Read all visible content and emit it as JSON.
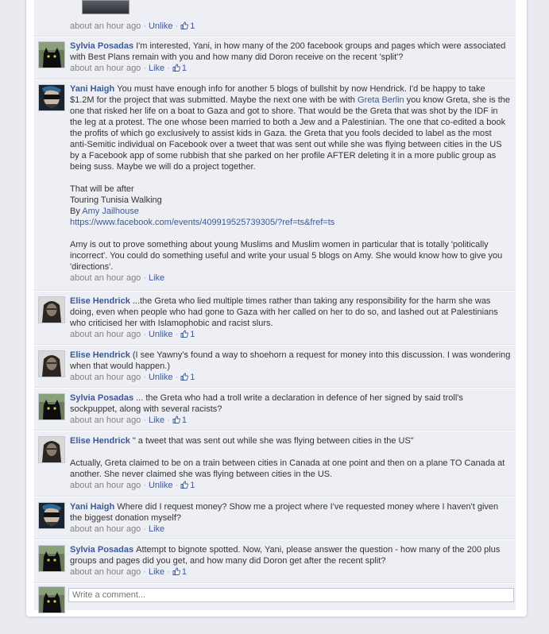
{
  "colors": {
    "link": "#3b5998",
    "meta": "#808080",
    "panel_bg": "#edeff4"
  },
  "first_meta": {
    "time": "about an hour ago",
    "action": "Unlike",
    "likes": "1"
  },
  "comments": [
    {
      "author": "Sylvia Posadas",
      "avatar_icon": "black-cat-avatar",
      "text": "I'm interested, Yani, in how many of the 200 facebook groups and pages which were associated with Best Plans remain with you and how many did Doron receive on the recent 'split'?",
      "time": "about an hour ago",
      "action": "Like",
      "likes": "1"
    },
    {
      "author": "Yani Haigh",
      "avatar_icon": "masked-face-avatar",
      "text_a": "You must have enough info for another 5 blogs of bullshit by now Hendrick. I'd be happy to take $1.2M for the project that was submitted. Maybe the next one with be with",
      "link_a": "Greta Berlin",
      "text_b": "you know Greta, she is the one that risked her life on a boat to Gaza and got to shore. That would be the Greta that was shot by the IDF in the leg at a protest. The one whose been married to both a Jew and a Palestinian. The one that co-edited a book the profits of which go exclusively to assist kids in Gaza. the Greta that you fools decided to label as the most anti-Semitic individual on Facebook over a tweet that was sent out while she was flying between cities in the US by a Facebook app of some rubbish that she parked on her profile AFTER deleting it in a more public group as being suss. Maybe we will do a project together.",
      "line1": "That will be after",
      "line2": "Touring Tunisia Walking",
      "by_label": "By",
      "by_link": "Amy Jailhouse",
      "url": "https://www.facebook.com/events/409919525739305/?ref=ts&fref=ts",
      "text_c": "Amy is out to prove something about young Muslims and Muslim women in particular that is totally 'politically incorrect'. You could do something useful and write your usual 5 blogs on Amy. She would know how to give you 'directions'.",
      "time": "about an hour ago",
      "action": "Like"
    },
    {
      "author": "Elise Hendrick",
      "avatar_icon": "woman-face-avatar",
      "text": "...the Greta who lied multiple times rather than taking any responsibility for the harm she was doing, even when people who had gone to Gaza with her called on her to do so, and lashed out at Palestinians who criticised her with Islamophobic and racist slurs.",
      "time": "about an hour ago",
      "action": "Unlike",
      "likes": "1"
    },
    {
      "author": "Elise Hendrick",
      "avatar_icon": "woman-face-avatar",
      "text": "(I see Yawny's found a way to shoehorn a request for money into this discussion. I was wondering when that would happen.)",
      "time": "about an hour ago",
      "action": "Unlike",
      "likes": "1"
    },
    {
      "author": "Sylvia Posadas",
      "avatar_icon": "black-cat-avatar",
      "text": "... the Greta who had a troll write a declaration in defence of her signed by said troll's sockpuppet, along with several racists?",
      "time": "about an hour ago",
      "action": "Like",
      "likes": "1"
    },
    {
      "author": "Elise Hendrick",
      "avatar_icon": "woman-face-avatar",
      "text": "\" a tweet that was sent out while she was flying between cities in the US\"",
      "text2": "Actually, Greta claimed to be on a train between cities in Canada at one point and then on a plane TO Canada at another. She never claimed she was flying between cities in the US.",
      "time": "about an hour ago",
      "action": "Unlike",
      "likes": "1"
    },
    {
      "author": "Yani Haigh",
      "avatar_icon": "masked-face-avatar",
      "text": "Where did I request money? Show me a project where I've requested money where I haven't given the biggest donation myself?",
      "time": "about an hour ago",
      "action": "Like"
    },
    {
      "author": "Sylvia Posadas",
      "avatar_icon": "black-cat-avatar",
      "text": "Attempt to bignote spotted. Now, Yani, please answer the question - how many of the 200 plus groups and pages did you get, and how many did Doron get after the recent split?",
      "time": "about an hour ago",
      "action": "Like",
      "likes": "1"
    }
  ],
  "comment_box": {
    "placeholder": "Write a comment..."
  }
}
